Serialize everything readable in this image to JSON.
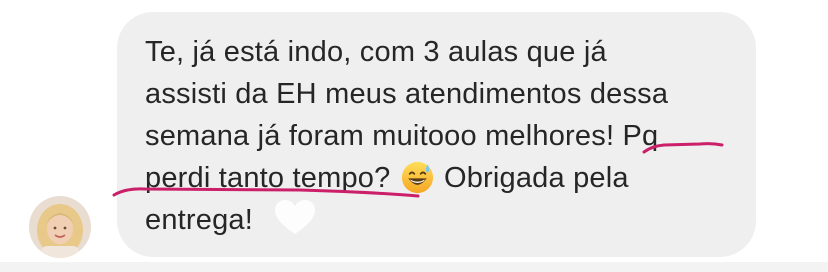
{
  "message": {
    "line1": "Te, já está indo, com 3 aulas que já",
    "line2": "assisti da EH meus atendimentos dessa",
    "line3": "semana já foram muitooo melhores! Pq",
    "line4_before_emoji": "perdi tanto tempo? ",
    "line4_after_emoji": " Obrigada pela",
    "line5": "entrega!"
  },
  "emoji": "grinning-face-with-sweat",
  "reaction": "heart-icon",
  "annotation": {
    "color": "#cc1f6a"
  },
  "colors": {
    "bubble": "#efefef",
    "text": "#262626",
    "background": "#ffffff"
  }
}
